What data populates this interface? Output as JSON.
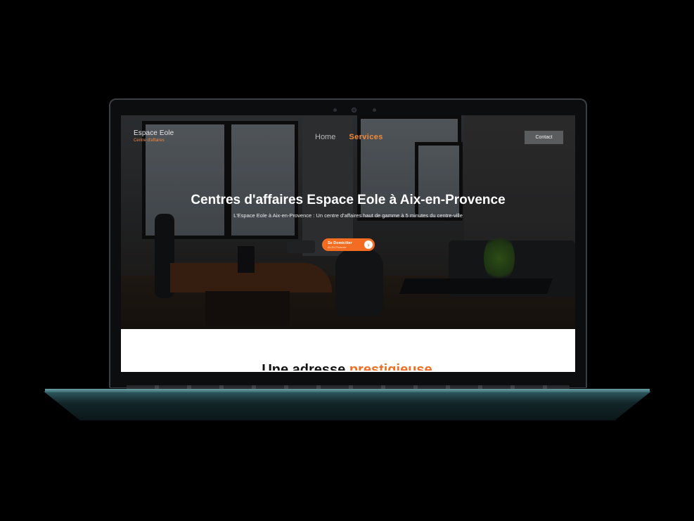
{
  "logo": {
    "name": "Espace Eole",
    "tagline": "Centre d'affaires"
  },
  "nav": {
    "items": [
      {
        "label": "Home"
      },
      {
        "label": "Services"
      }
    ],
    "active": "Services",
    "contact_label": "Contact"
  },
  "hero": {
    "title": "Centres d'affaires Espace Eole à Aix-en-Provence",
    "subtitle": "L'Espace Eole à Aix-en-Provence : Un centre d'affaires haut de gamme à 5 minutes du centre-ville",
    "cta_label": "Se Domicilier",
    "cta_sublabel": "Aix-En-Provence"
  },
  "section": {
    "heading_main": "Une adresse",
    "heading_accent": "prestigieuse"
  },
  "colors": {
    "accent": "#f26d21",
    "laptop_base": "#2f5a61"
  }
}
